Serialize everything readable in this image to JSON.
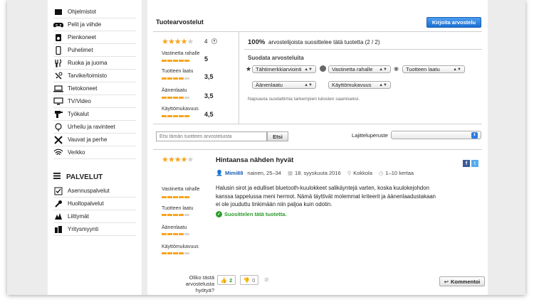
{
  "sidebar": {
    "categories": [
      {
        "label": "Ohjelmistot",
        "icon": "software-icon"
      },
      {
        "label": "Pelit ja viihde",
        "icon": "gamepad-icon"
      },
      {
        "label": "Pienkoneet",
        "icon": "appliance-icon"
      },
      {
        "label": "Puhelimet",
        "icon": "phone-icon"
      },
      {
        "label": "Ruoka ja juoma",
        "icon": "food-icon"
      },
      {
        "label": "Tarvike/toimisto",
        "icon": "office-icon"
      },
      {
        "label": "Tietokoneet",
        "icon": "laptop-icon"
      },
      {
        "label": "TV/Video",
        "icon": "tv-icon"
      },
      {
        "label": "Työkalut",
        "icon": "drill-icon"
      },
      {
        "label": "Urheilu ja ravinteet",
        "icon": "sport-icon"
      },
      {
        "label": "Vauvat ja perhe",
        "icon": "baby-icon"
      },
      {
        "label": "Verkko",
        "icon": "wifi-icon"
      }
    ],
    "services_title": "PALVELUT",
    "services": [
      {
        "label": "Asennuspalvelut",
        "icon": "checkbox-icon"
      },
      {
        "label": "Huoltopalvelut",
        "icon": "wrench-icon"
      },
      {
        "label": "Liittymät",
        "icon": "signal-icon"
      },
      {
        "label": "Yritysmyynti",
        "icon": "building-icon"
      }
    ]
  },
  "reviews": {
    "title": "Tuotearvostelut",
    "write_button": "Kirjoita arvostelu",
    "overall_rating": "4",
    "recommend_percent": "100%",
    "recommend_text": "arvostelijoista suosittelee tätä tuotetta (2 / 2)",
    "metrics": [
      {
        "label": "Vastinetta rahalle",
        "value": "5",
        "level": 5
      },
      {
        "label": "Tuotteen laatu",
        "value": "3,5",
        "level": 3.5
      },
      {
        "label": "Äänenlaatu",
        "value": "3,5",
        "level": 3.5
      },
      {
        "label": "Käyttömukavuus",
        "value": "4,5",
        "level": 4.5
      }
    ],
    "filter_title": "Suodata arvosteluita",
    "filters": [
      "Tähtimerkkiarviointi",
      "Vastinetta rahalle",
      "Tuotteen laatu",
      "Äänenlaatu",
      "Käyttömukavuus"
    ],
    "filter_hint": "Napsauta suodattimia tarkempien tulosten saamiseksi.",
    "search_placeholder": "Etsi tämän tuotteen arvosteluista",
    "search_button": "Etsi",
    "sort_label": "Lajitteluperuste",
    "sort_value": ""
  },
  "review": {
    "rating": 4,
    "title": "Hintaansa nähden hyvät",
    "author": "Mimi88",
    "author_meta": "nainen, 25–34",
    "date": "18. syyskuuta 2016",
    "location": "Kokkola",
    "frequency": "1–10 kertaa",
    "body": "Halusin sirot ja edulliset bluetooth-kuulokkeet salikäyntejä varten, koska kuulokejohdon kanssa tappelussa meni hermot. Nämä täyttivät molemmat kriteerit ja äänenlaadustakaan ei ole jouduttu tinkimään niin paljoa kuin odotin.",
    "recommend": "Suosittelen tätä tuotetta.",
    "metrics": [
      {
        "label": "Vastinetta rahalle",
        "level": 5
      },
      {
        "label": "Tuotteen laatu",
        "level": 4
      },
      {
        "label": "Äänenlaatu",
        "level": 4
      },
      {
        "label": "Käyttömukavuus",
        "level": 4
      }
    ],
    "helpful_question": "Oliko tästä arvostelusta hyötyä?",
    "helpful_yes": "2",
    "helpful_no": "0",
    "comment_button": "Kommentoi"
  },
  "colors": {
    "accent": "#1c6fd1",
    "star": "#f7a41d",
    "green": "#2a9d2a",
    "link": "#1a5fb4"
  }
}
